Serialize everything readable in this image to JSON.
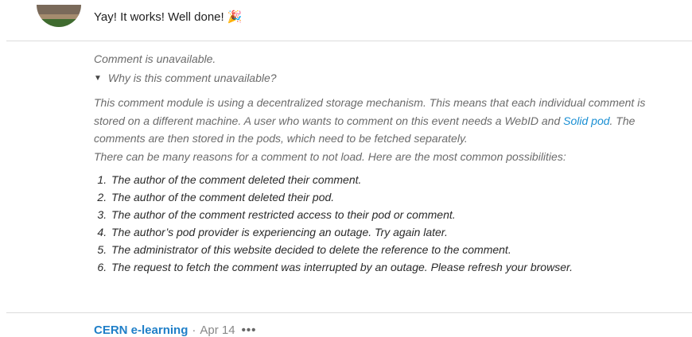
{
  "previous_comment": {
    "text": "Yay! It works! Well done!",
    "emoji": "🎉"
  },
  "unavailable": {
    "title": "Comment is unavailable.",
    "summary_label": "Why is this comment unavailable?",
    "expanded": true,
    "explanation_part1": "This comment module is using a decentralized storage mechanism. This means that each individual comment is stored on a different machine. A user who wants to comment on this event needs a WebID and ",
    "link_text": "Solid pod",
    "explanation_part2": ". The comments are then stored in the pods, which need to be fetched separately.",
    "reasons_intro": "There can be many reasons for a comment to not load. Here are the most common possibilities:",
    "reasons": [
      "The author of the comment deleted their comment.",
      "The author of the comment deleted their pod.",
      "The author of the comment restricted access to their pod or comment.",
      "The author’s pod provider is experiencing an outage. Try again later.",
      "The administrator of this website decided to delete the reference to the comment.",
      "The request to fetch the comment was interrupted by an outage. Please refresh your browser."
    ]
  },
  "next_comment": {
    "author": "CERN e-learning",
    "separator": "·",
    "date": "Apr 14",
    "more_label": "•••"
  },
  "colors": {
    "link": "#1a8fd3",
    "muted_text": "#6b6b6b",
    "divider": "#dcdcdc"
  }
}
